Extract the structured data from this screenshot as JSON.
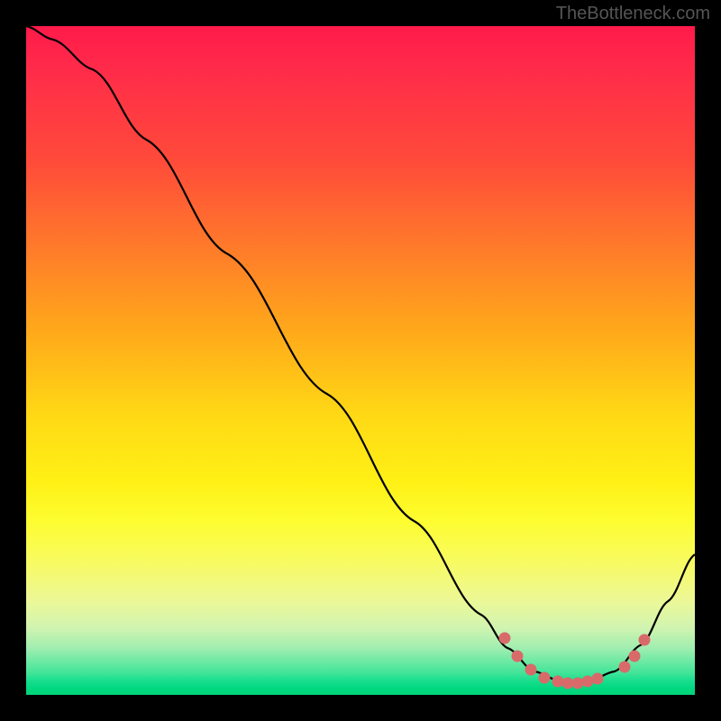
{
  "watermark": "TheBottleneck.com",
  "chart_data": {
    "type": "line",
    "title": "",
    "xlabel": "",
    "ylabel": "",
    "xlim": [
      0,
      1
    ],
    "ylim": [
      0,
      1
    ],
    "series": [
      {
        "name": "curve",
        "points": [
          {
            "x": 0.0,
            "y": 1.0
          },
          {
            "x": 0.04,
            "y": 0.98
          },
          {
            "x": 0.1,
            "y": 0.935
          },
          {
            "x": 0.18,
            "y": 0.83
          },
          {
            "x": 0.3,
            "y": 0.66
          },
          {
            "x": 0.45,
            "y": 0.45
          },
          {
            "x": 0.58,
            "y": 0.26
          },
          {
            "x": 0.68,
            "y": 0.12
          },
          {
            "x": 0.72,
            "y": 0.07
          },
          {
            "x": 0.76,
            "y": 0.035
          },
          {
            "x": 0.8,
            "y": 0.02
          },
          {
            "x": 0.84,
            "y": 0.02
          },
          {
            "x": 0.88,
            "y": 0.035
          },
          {
            "x": 0.92,
            "y": 0.075
          },
          {
            "x": 0.96,
            "y": 0.14
          },
          {
            "x": 1.0,
            "y": 0.21
          }
        ]
      }
    ],
    "dots": [
      {
        "x": 0.715,
        "y": 0.085
      },
      {
        "x": 0.735,
        "y": 0.058
      },
      {
        "x": 0.755,
        "y": 0.038
      },
      {
        "x": 0.775,
        "y": 0.025
      },
      {
        "x": 0.795,
        "y": 0.02
      },
      {
        "x": 0.81,
        "y": 0.018
      },
      {
        "x": 0.825,
        "y": 0.018
      },
      {
        "x": 0.84,
        "y": 0.02
      },
      {
        "x": 0.855,
        "y": 0.024
      },
      {
        "x": 0.895,
        "y": 0.042
      },
      {
        "x": 0.91,
        "y": 0.058
      },
      {
        "x": 0.925,
        "y": 0.082
      }
    ]
  }
}
